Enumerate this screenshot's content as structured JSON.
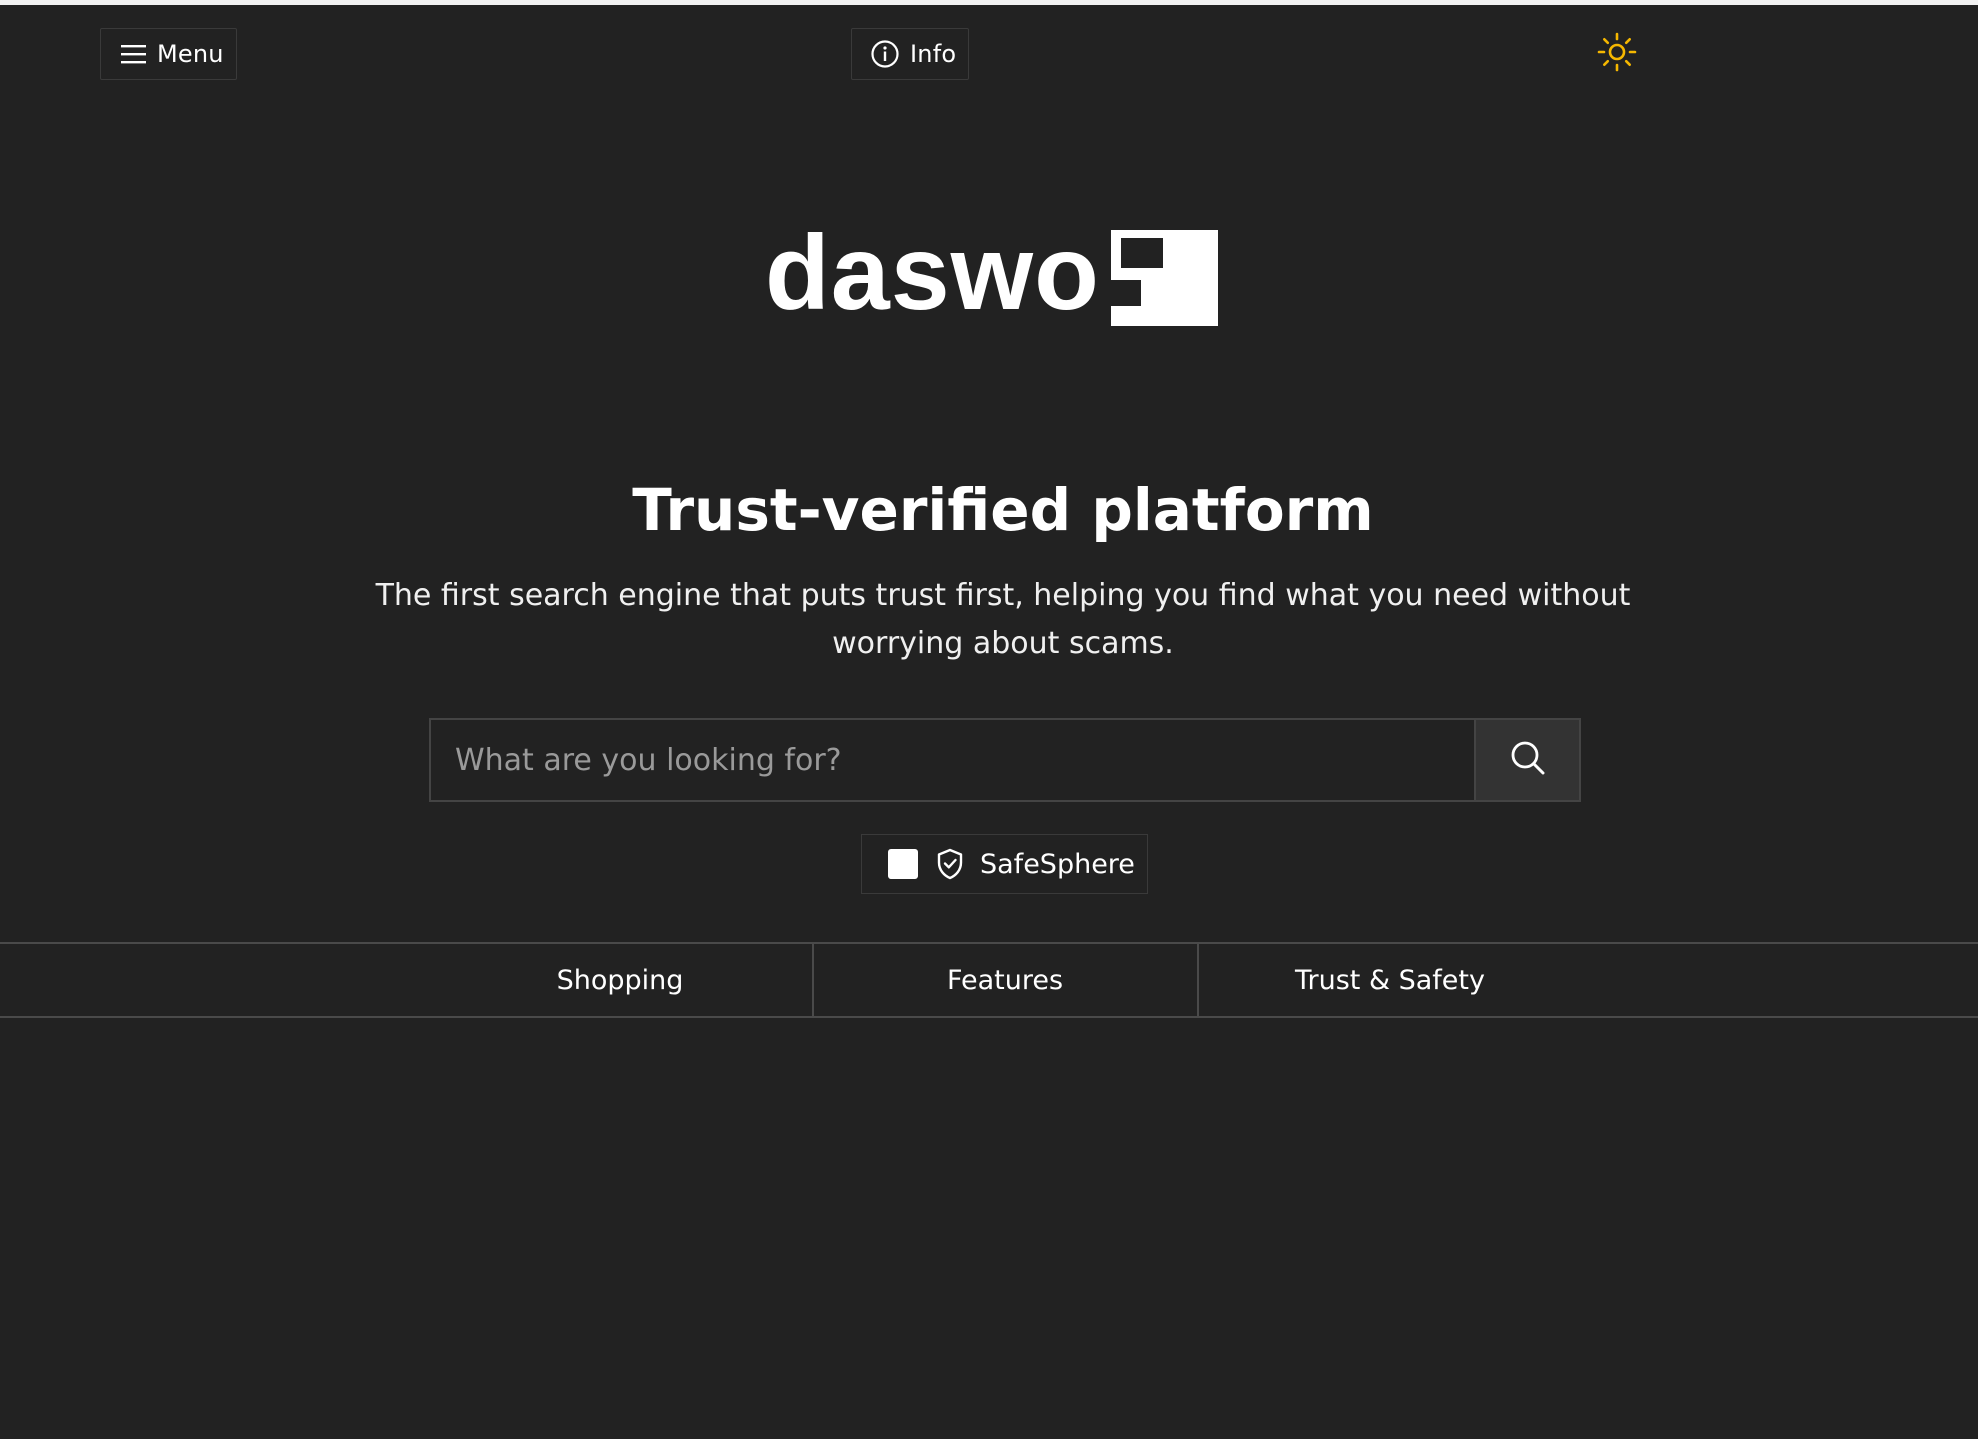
{
  "header": {
    "menu_label": "Menu",
    "menu_icon": "hamburger-icon",
    "info_label": "Info",
    "info_icon": "info-circle-icon",
    "theme_icon": "sun-icon",
    "theme_icon_color": "#f5b700"
  },
  "logo": {
    "text": "daswo"
  },
  "hero": {
    "title": "Trust-verified platform",
    "subtitle": "The first search engine that puts trust first, helping you find what you need without worrying about scams."
  },
  "search": {
    "placeholder": "What are you looking for?",
    "value": "",
    "button_icon": "search-icon"
  },
  "safesphere": {
    "label": "SafeSphere",
    "checked": false,
    "icon": "shield-check-icon"
  },
  "tabs": [
    {
      "label": "Shopping"
    },
    {
      "label": "Features"
    },
    {
      "label": "Trust & Safety"
    }
  ],
  "colors": {
    "background": "#222222",
    "text": "#ffffff",
    "border": "#444444",
    "accent": "#f5b700"
  }
}
